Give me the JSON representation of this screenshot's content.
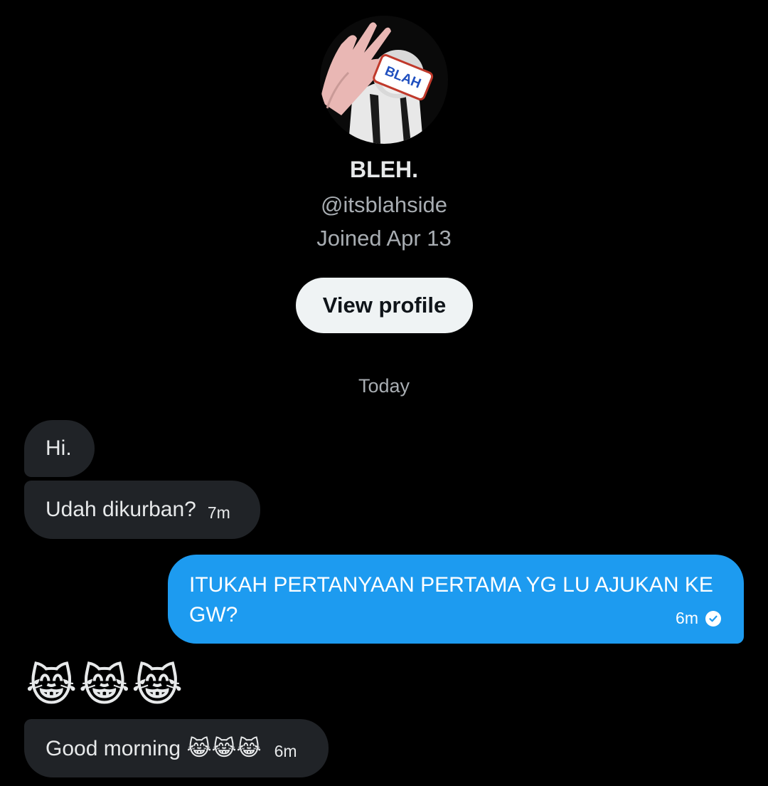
{
  "profile": {
    "display_name": "BLEH.",
    "handle": "@itsblahside",
    "joined": "Joined Apr 13",
    "view_profile_label": "View profile",
    "avatar_sticker_text": "BLAH"
  },
  "conversation": {
    "date_divider": "Today",
    "messages": [
      {
        "direction": "incoming",
        "text": "Hi.",
        "time": ""
      },
      {
        "direction": "incoming",
        "text": "Udah dikurban?",
        "time": "7m"
      },
      {
        "direction": "outgoing",
        "text": "ITUKAH PERTANYAAN PERTAMA YG LU AJUKAN KE GW?",
        "time": "6m",
        "status_icon": "check-circle-icon"
      },
      {
        "direction": "incoming",
        "text": "😹😹😹",
        "time": ""
      },
      {
        "direction": "incoming",
        "text": "Good morning 😹😹😹",
        "time": "6m"
      }
    ]
  },
  "colors": {
    "background": "#000000",
    "incoming_bubble": "#202327",
    "outgoing_bubble": "#1d9bf0",
    "secondary_text": "#a8adb2",
    "button_bg": "#eff3f4"
  }
}
